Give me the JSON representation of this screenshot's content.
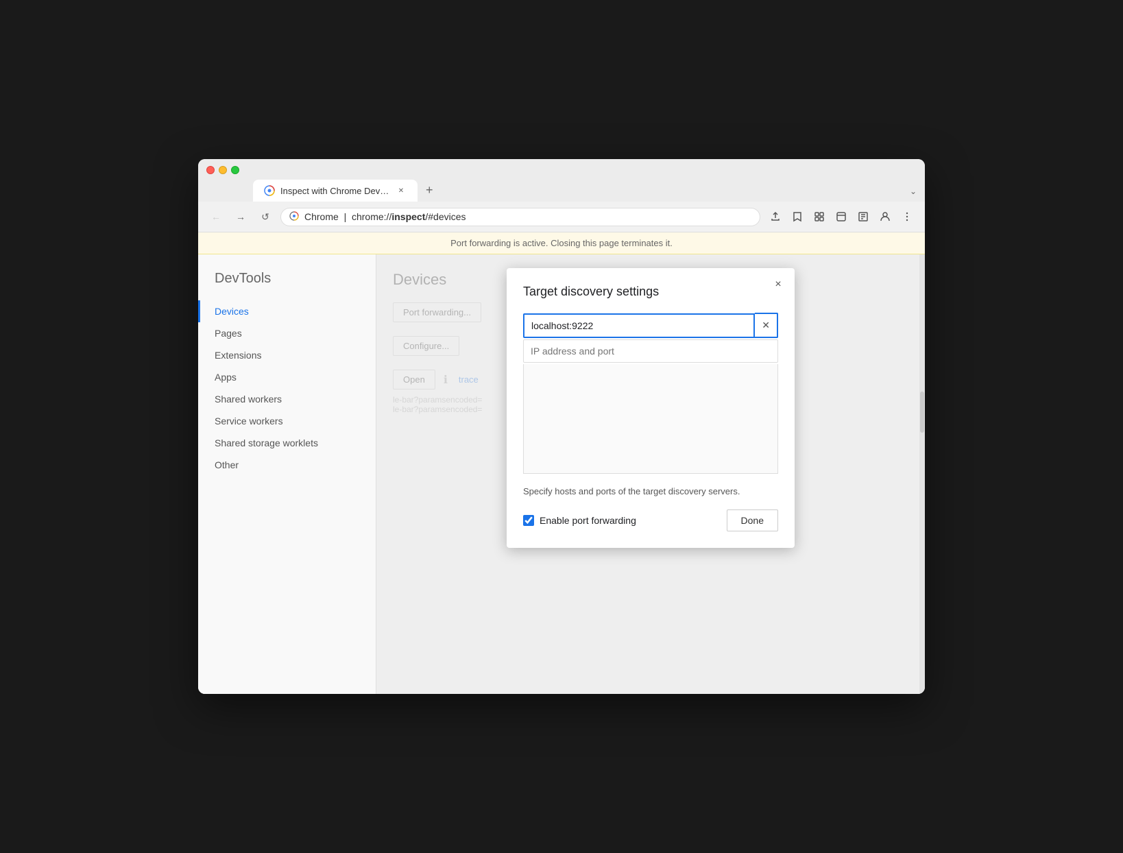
{
  "browser": {
    "title": "Inspect with Chrome Developer Tools",
    "tab_title": "Inspect with Chrome Develope...",
    "url_prefix": "Chrome  |  chrome://",
    "url_bold": "inspect",
    "url_suffix": "/#devices",
    "url_full": "chrome://inspect/#devices"
  },
  "info_banner": {
    "text": "Port forwarding is active. Closing this page terminates it."
  },
  "sidebar": {
    "title": "DevTools",
    "items": [
      {
        "label": "Devices",
        "active": true
      },
      {
        "label": "Pages",
        "active": false
      },
      {
        "label": "Extensions",
        "active": false
      },
      {
        "label": "Apps",
        "active": false
      },
      {
        "label": "Shared workers",
        "active": false
      },
      {
        "label": "Service workers",
        "active": false
      },
      {
        "label": "Shared storage worklets",
        "active": false
      },
      {
        "label": "Other",
        "active": false
      }
    ]
  },
  "content": {
    "page_title": "Devices",
    "buttons": {
      "port_forwarding": "Port forwarding...",
      "configure": "Configure...",
      "open": "Open",
      "trace": "trace"
    },
    "url_hint1": "le-bar?paramsencoded=",
    "url_hint2": "le-bar?paramsencoded="
  },
  "modal": {
    "title": "Target discovery settings",
    "input_value": "localhost:9222",
    "input_placeholder": "IP address and port",
    "hint": "Specify hosts and ports of the target\ndiscovery servers.",
    "enable_forwarding_label": "Enable port forwarding",
    "done_button": "Done",
    "close_icon": "×"
  },
  "nav": {
    "back": "←",
    "forward": "→",
    "reload": "↺"
  }
}
